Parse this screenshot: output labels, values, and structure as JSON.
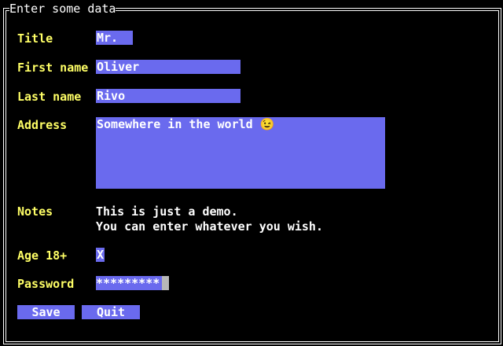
{
  "form": {
    "title": "Enter some data",
    "fields": {
      "title": {
        "label": "Title",
        "value": "Mr."
      },
      "first_name": {
        "label": "First name",
        "value": "Oliver"
      },
      "last_name": {
        "label": "Last name",
        "value": "Rivo"
      },
      "address": {
        "label": "Address",
        "value": "Somewhere in the world 😉"
      },
      "notes": {
        "label": "Notes",
        "line1": "This is just a demo.",
        "line2": "You can enter whatever you wish."
      },
      "age": {
        "label": "Age 18+",
        "value": "X"
      },
      "password": {
        "label": "Password",
        "value": "*********"
      }
    },
    "buttons": {
      "save": "Save",
      "quit": "Quit"
    }
  }
}
